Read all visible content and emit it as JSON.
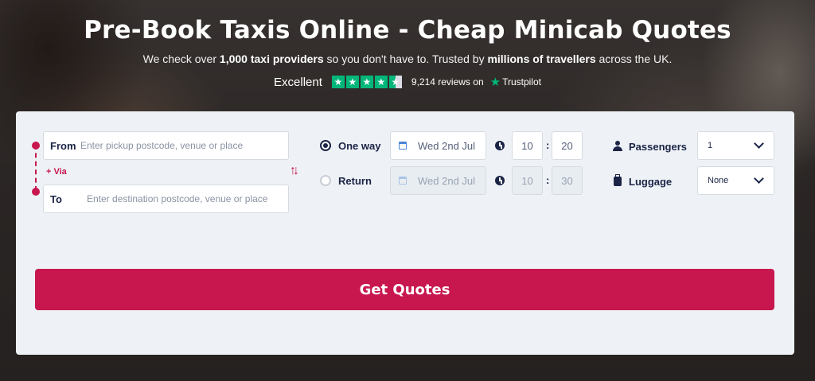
{
  "hero": {
    "title": "Pre-Book Taxis Online - Cheap Minicab Quotes",
    "subtitle_prefix": "We check over ",
    "subtitle_bold1": "1,000 taxi providers",
    "subtitle_mid": " so you don't have to. Trusted by ",
    "subtitle_bold2": "millions of travellers",
    "subtitle_suffix": " across the UK."
  },
  "rating": {
    "label": "Excellent",
    "stars": 4.5,
    "reviews_text": "9,214 reviews on",
    "provider": "Trustpilot",
    "star_color": "#00b67a"
  },
  "route": {
    "from_label": "From",
    "from_placeholder": "Enter pickup postcode, venue or place",
    "via_label": "+ Via",
    "to_label": "To",
    "to_placeholder": "Enter destination postcode, venue or place"
  },
  "trip": {
    "one_way_label": "One way",
    "return_label": "Return",
    "selected": "One way",
    "outbound_date": "Wed 2nd Jul",
    "outbound_hour": "10",
    "outbound_minute": "20",
    "return_date": "Wed 2nd Jul",
    "return_hour": "10",
    "return_minute": "30"
  },
  "options": {
    "passengers_label": "Passengers",
    "passengers_value": "1",
    "luggage_label": "Luggage",
    "luggage_value": "None"
  },
  "cta": {
    "label": "Get Quotes"
  },
  "colors": {
    "accent": "#c8164f",
    "navy": "#1b2447",
    "card": "#eef2f6"
  }
}
